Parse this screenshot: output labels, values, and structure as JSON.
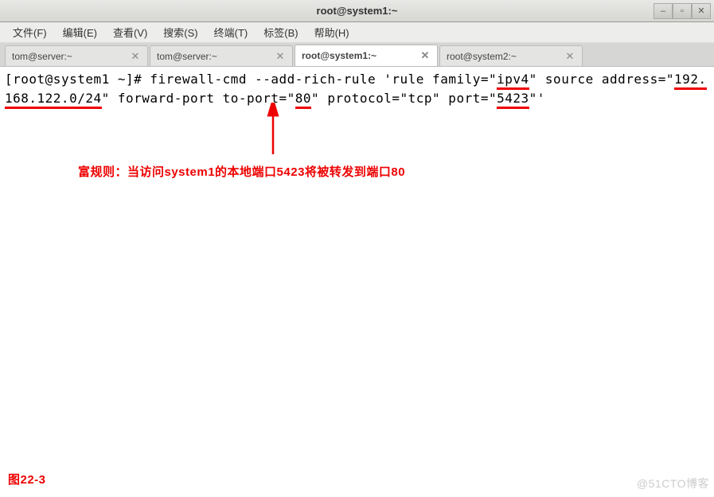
{
  "titlebar": {
    "title": "root@system1:~"
  },
  "window_controls": {
    "min": "–",
    "max": "▫",
    "close": "✕"
  },
  "menubar": {
    "file": "文件(F)",
    "edit": "编辑(E)",
    "view": "查看(V)",
    "search": "搜索(S)",
    "terminal": "终端(T)",
    "tabs": "标签(B)",
    "help": "帮助(H)"
  },
  "tabs": {
    "t0": {
      "label": "tom@server:~"
    },
    "t1": {
      "label": "tom@server:~"
    },
    "t2": {
      "label": "root@system1:~"
    },
    "t3": {
      "label": "root@system2:~"
    }
  },
  "terminal": {
    "prompt_open": "[",
    "prompt_user": "root@system1",
    "prompt_path": " ~]# ",
    "cmd_p1": "firewall-cmd --add-rich-rule 'rule family=\"",
    "ipv4": "ipv4",
    "cmd_p2": "\" source address=\"",
    "addr": "192.168.122.0/24",
    "cmd_p3": "\" forward-port to-port=\"",
    "port80": "80",
    "cmd_p4": "\" protocol=\"tcp\" port=\"",
    "port5423": "5423",
    "cmd_p5": "\"'"
  },
  "annotation": {
    "text": "富规则：当访问system1的本地端口5423将被转发到端口80"
  },
  "figure": "图22-3",
  "watermark": "@51CTO博客"
}
